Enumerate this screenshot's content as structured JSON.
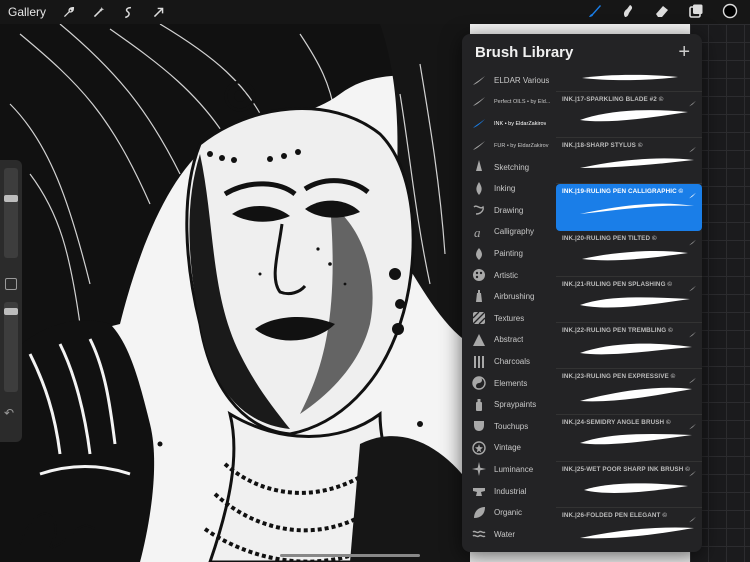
{
  "toolbar": {
    "gallery_label": "Gallery",
    "left_icons": [
      "wrench-icon",
      "magic-wand-icon",
      "selection-icon",
      "transform-arrow-icon"
    ],
    "right_icons": [
      "brush-icon",
      "smudge-icon",
      "eraser-icon",
      "layers-icon",
      "color-circle-icon"
    ],
    "accent_color": "#1a7ee8"
  },
  "sidebar": {
    "brush_size_level": 0.2,
    "opacity_level": 0.05,
    "icons": [
      "modify-square-icon",
      "undo-icon"
    ]
  },
  "panel": {
    "title": "Brush Library",
    "add_label": "+",
    "sets": [
      {
        "label": "ELDAR Various",
        "icon": "stroke-icon"
      },
      {
        "label": "Perfect OILS • by Eld...",
        "icon": "stroke-icon"
      },
      {
        "label": "INK • by EldarZakirov",
        "icon": "stroke-icon",
        "active": true
      },
      {
        "label": "FUR • by EldarZakirov",
        "icon": "stroke-icon"
      },
      {
        "label": "Sketching",
        "icon": "pencil-icon"
      },
      {
        "label": "Inking",
        "icon": "ink-drop-icon"
      },
      {
        "label": "Drawing",
        "icon": "squiggle-icon"
      },
      {
        "label": "Calligraphy",
        "icon": "calligraphy-icon"
      },
      {
        "label": "Painting",
        "icon": "paint-drop-icon"
      },
      {
        "label": "Artistic",
        "icon": "palette-icon"
      },
      {
        "label": "Airbrushing",
        "icon": "airbrush-icon"
      },
      {
        "label": "Textures",
        "icon": "texture-icon"
      },
      {
        "label": "Abstract",
        "icon": "triangle-icon"
      },
      {
        "label": "Charcoals",
        "icon": "charcoal-icon"
      },
      {
        "label": "Elements",
        "icon": "yin-yang-icon"
      },
      {
        "label": "Spraypaints",
        "icon": "spray-icon"
      },
      {
        "label": "Touchups",
        "icon": "touchup-icon"
      },
      {
        "label": "Vintage",
        "icon": "star-icon"
      },
      {
        "label": "Luminance",
        "icon": "sparkle-icon"
      },
      {
        "label": "Industrial",
        "icon": "anvil-icon"
      },
      {
        "label": "Organic",
        "icon": "leaf-icon"
      },
      {
        "label": "Water",
        "icon": "wave-icon"
      }
    ],
    "brushes": [
      {
        "name": ""
      },
      {
        "name": "INK.|17-SPARKLING BLADE #2 ©"
      },
      {
        "name": "INK.|18-SHARP STYLUS ©"
      },
      {
        "name": "INK.|19-RULING PEN CALLIGRAPHIC ©",
        "selected": true
      },
      {
        "name": "INK.|20-RULING PEN TILTED ©"
      },
      {
        "name": "INK.|21-RULING PEN SPLASHING ©"
      },
      {
        "name": "INK.|22-RULING PEN TREMBLING ©"
      },
      {
        "name": "INK.|23-RULING PEN EXPRESSIVE ©"
      },
      {
        "name": "INK.|24-SEMIDRY ANGLE BRUSH ©"
      },
      {
        "name": "INK.|25-WET POOR SHARP INK BRUSH ©"
      },
      {
        "name": "INK.|26-FOLDED PEN ELEGANT ©"
      }
    ]
  }
}
